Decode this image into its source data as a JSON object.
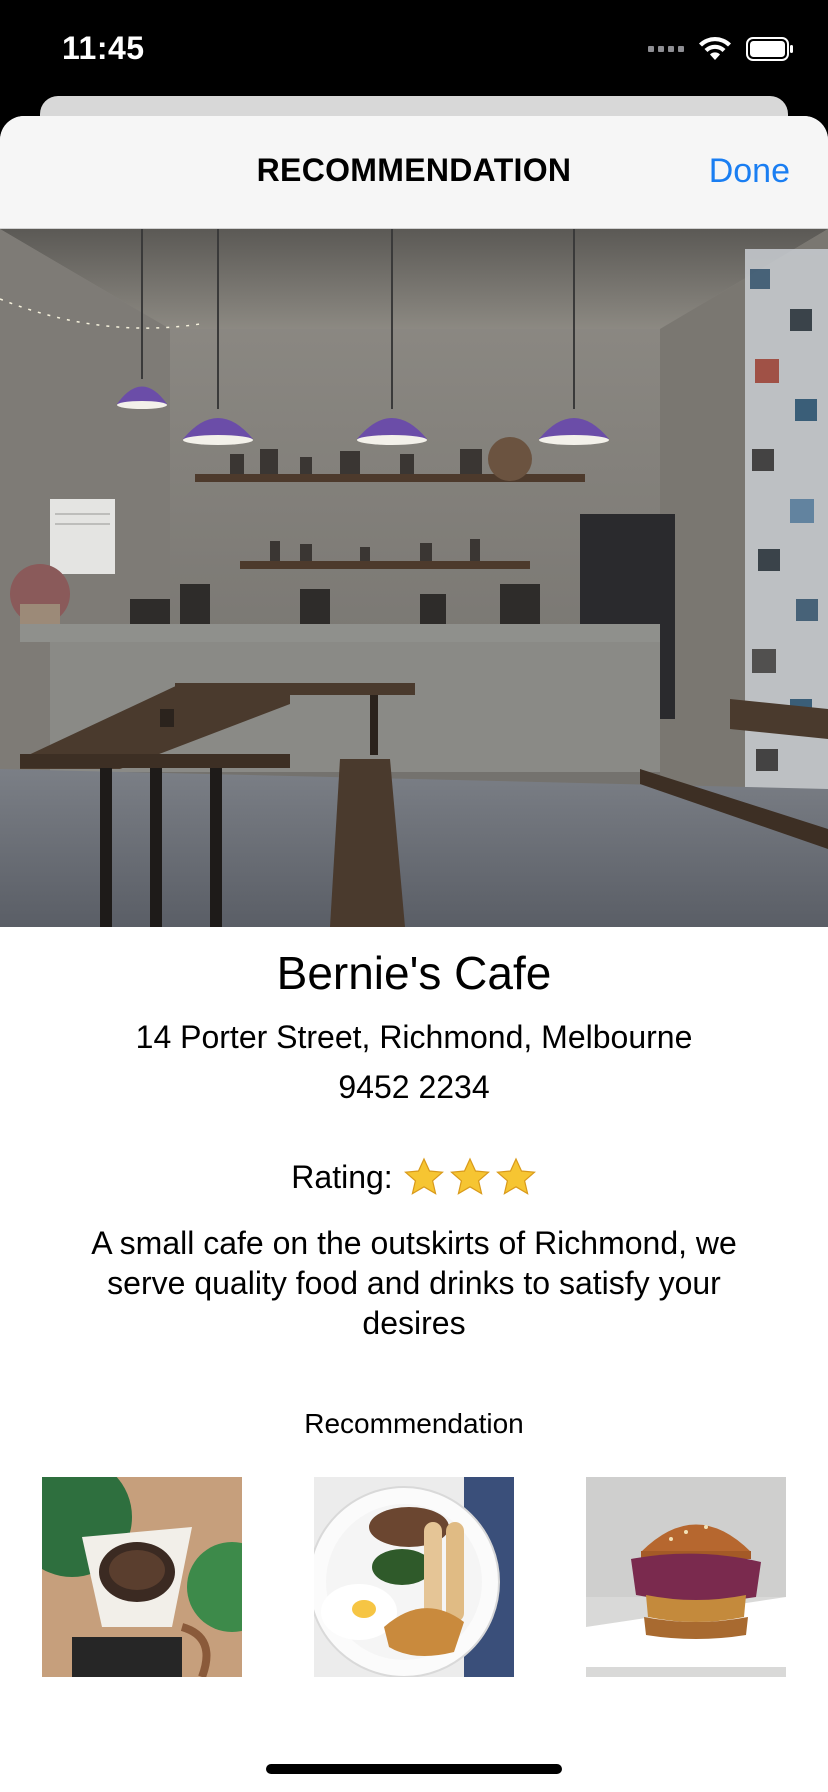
{
  "status_bar": {
    "time": "11:45",
    "icons": [
      "cellular-signal-icon",
      "wifi-icon",
      "battery-icon"
    ]
  },
  "nav": {
    "title": "RECOMMENDATION",
    "done_label": "Done"
  },
  "colors": {
    "accent": "#1a7ef2",
    "nav_background": "#f6f6f6",
    "star": "#f6c532"
  },
  "cafe": {
    "name": "Bernie's Cafe",
    "address": "14 Porter Street, Richmond, Melbourne",
    "phone": "9452 2234",
    "rating_label": "Rating:",
    "rating_stars": 3,
    "description": "A small cafe on the outskirts of Richmond, we serve quality food and drinks to satisfy your desires"
  },
  "recommendations": {
    "heading": "Recommendation",
    "items": [
      "coffee-dripper-photo",
      "breakfast-plate-photo",
      "burger-photo"
    ]
  }
}
